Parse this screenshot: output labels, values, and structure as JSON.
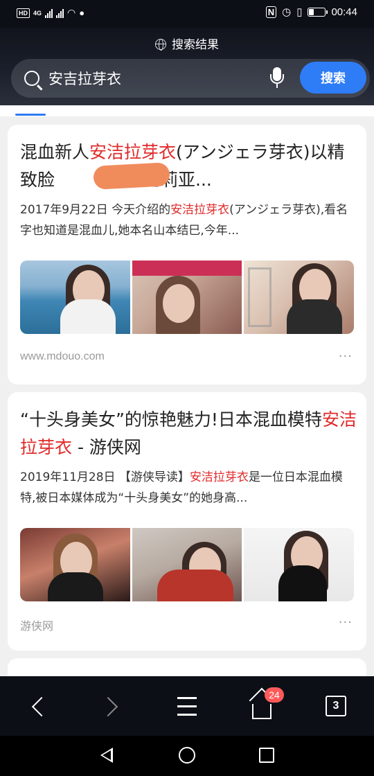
{
  "status_bar": {
    "hd": "HD",
    "network": "4G",
    "time": "00:44",
    "battery_level": 0.35,
    "icons": [
      "signal-icon",
      "wifi-icon",
      "qq-icon",
      "nfc-icon",
      "alarm-icon",
      "vibrate-icon",
      "battery-icon"
    ]
  },
  "header": {
    "caption": "搜索结果",
    "query": "安吉拉芽衣",
    "search_button": "搜索"
  },
  "results": [
    {
      "title_pre": "混血新人",
      "title_hl": "安洁拉芽衣",
      "title_post": "(アンジェラ芽衣)以精致脸",
      "title_tail": "孔堪比莉亚...",
      "snippet_date": "2017年9月22日",
      "snippet_pre": " 今天介绍的",
      "snippet_hl": "安洁拉芽衣",
      "snippet_post": "(アンジェラ芽衣),看名字也知道是混血儿,她本名山本结巳,今年...",
      "source": "www.mdouo.com",
      "more": "···"
    },
    {
      "title_pre": "“十头身美女”的惊艳魅力!日本混血模特",
      "title_hl": "安洁拉芽衣",
      "title_post": " - 游侠网",
      "snippet_date": "2019年11月28日",
      "snippet_pre": " 【游侠导读】",
      "snippet_hl": "安洁拉芽衣",
      "snippet_post": "是一位日本混血模特,被日本媒体成为“十头身美女”的她身高...",
      "source": "游侠网",
      "more": "···"
    }
  ],
  "bottom_nav": {
    "home_badge": "24",
    "tab_count": "3"
  },
  "colors": {
    "accent": "#2e7cf6",
    "highlight": "#e02a2a",
    "badge": "#ff5a5a"
  }
}
